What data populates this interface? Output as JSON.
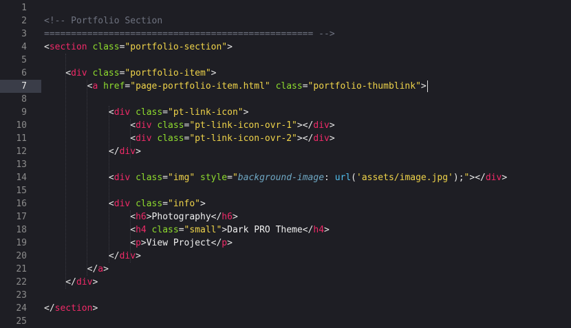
{
  "editor": {
    "language": "html",
    "active_line": 7,
    "colors": {
      "background": "#1e1e24",
      "active_line": "#3a3d48",
      "tag": "#f02a68",
      "attribute": "#8fdc2e",
      "string": "#f0d44a",
      "comment": "#6f7380",
      "function": "#52c0f0",
      "css_property": "#6fa8c4"
    },
    "lines": [
      [],
      [
        [
          "comment",
          "<!-- Portfolio Section"
        ]
      ],
      [
        [
          "comment",
          "================================================== -->"
        ]
      ],
      [
        [
          "punc",
          "<"
        ],
        [
          "tag",
          "section"
        ],
        [
          "punc",
          " "
        ],
        [
          "attr",
          "class"
        ],
        [
          "punc",
          "="
        ],
        [
          "str",
          "\"portfolio-section\""
        ],
        [
          "punc",
          ">"
        ]
      ],
      [],
      [
        [
          "punc",
          "    <"
        ],
        [
          "tag",
          "div"
        ],
        [
          "punc",
          " "
        ],
        [
          "attr",
          "class"
        ],
        [
          "punc",
          "="
        ],
        [
          "str",
          "\"portfolio-item\""
        ],
        [
          "punc",
          ">"
        ]
      ],
      [
        [
          "punc",
          "        <"
        ],
        [
          "tag",
          "a"
        ],
        [
          "punc",
          " "
        ],
        [
          "attr",
          "href"
        ],
        [
          "punc",
          "="
        ],
        [
          "str",
          "\"page-portfolio-item.html\""
        ],
        [
          "punc",
          " "
        ],
        [
          "attr",
          "class"
        ],
        [
          "punc",
          "="
        ],
        [
          "str",
          "\"portfolio-thumblink\""
        ],
        [
          "punc",
          ">"
        ]
      ],
      [],
      [
        [
          "punc",
          "            <"
        ],
        [
          "tag",
          "div"
        ],
        [
          "punc",
          " "
        ],
        [
          "attr",
          "class"
        ],
        [
          "punc",
          "="
        ],
        [
          "str",
          "\"pt-link-icon\""
        ],
        [
          "punc",
          ">"
        ]
      ],
      [
        [
          "punc",
          "                <"
        ],
        [
          "tag",
          "div"
        ],
        [
          "punc",
          " "
        ],
        [
          "attr",
          "class"
        ],
        [
          "punc",
          "="
        ],
        [
          "str",
          "\"pt-link-icon-ovr-1\""
        ],
        [
          "punc",
          "></"
        ],
        [
          "tag",
          "div"
        ],
        [
          "punc",
          ">"
        ]
      ],
      [
        [
          "punc",
          "                <"
        ],
        [
          "tag",
          "div"
        ],
        [
          "punc",
          " "
        ],
        [
          "attr",
          "class"
        ],
        [
          "punc",
          "="
        ],
        [
          "str",
          "\"pt-link-icon-ovr-2\""
        ],
        [
          "punc",
          "></"
        ],
        [
          "tag",
          "div"
        ],
        [
          "punc",
          ">"
        ]
      ],
      [
        [
          "punc",
          "            </"
        ],
        [
          "tag",
          "div"
        ],
        [
          "punc",
          ">"
        ]
      ],
      [],
      [
        [
          "punc",
          "            <"
        ],
        [
          "tag",
          "div"
        ],
        [
          "punc",
          " "
        ],
        [
          "attr",
          "class"
        ],
        [
          "punc",
          "="
        ],
        [
          "str",
          "\"img\""
        ],
        [
          "punc",
          " "
        ],
        [
          "attr",
          "style"
        ],
        [
          "punc",
          "="
        ],
        [
          "str",
          "\""
        ],
        [
          "cssprop",
          "background-image"
        ],
        [
          "punc",
          ": "
        ],
        [
          "func",
          "url"
        ],
        [
          "punc",
          "("
        ],
        [
          "str",
          "'assets/image.jpg'"
        ],
        [
          "punc",
          ");"
        ],
        [
          "str",
          "\""
        ],
        [
          "punc",
          "></"
        ],
        [
          "tag",
          "div"
        ],
        [
          "punc",
          ">"
        ]
      ],
      [],
      [
        [
          "punc",
          "            <"
        ],
        [
          "tag",
          "div"
        ],
        [
          "punc",
          " "
        ],
        [
          "attr",
          "class"
        ],
        [
          "punc",
          "="
        ],
        [
          "str",
          "\"info\""
        ],
        [
          "punc",
          ">"
        ]
      ],
      [
        [
          "punc",
          "                <"
        ],
        [
          "tag",
          "h6"
        ],
        [
          "punc",
          ">"
        ],
        [
          "text",
          "Photography"
        ],
        [
          "punc",
          "</"
        ],
        [
          "tag",
          "h6"
        ],
        [
          "punc",
          ">"
        ]
      ],
      [
        [
          "punc",
          "                <"
        ],
        [
          "tag",
          "h4"
        ],
        [
          "punc",
          " "
        ],
        [
          "attr",
          "class"
        ],
        [
          "punc",
          "="
        ],
        [
          "str",
          "\"small\""
        ],
        [
          "punc",
          ">"
        ],
        [
          "text",
          "Dark PRO Theme"
        ],
        [
          "punc",
          "</"
        ],
        [
          "tag",
          "h4"
        ],
        [
          "punc",
          ">"
        ]
      ],
      [
        [
          "punc",
          "                <"
        ],
        [
          "tag",
          "p"
        ],
        [
          "punc",
          ">"
        ],
        [
          "text",
          "View Project"
        ],
        [
          "punc",
          "</"
        ],
        [
          "tag",
          "p"
        ],
        [
          "punc",
          ">"
        ]
      ],
      [
        [
          "punc",
          "            </"
        ],
        [
          "tag",
          "div"
        ],
        [
          "punc",
          ">"
        ]
      ],
      [
        [
          "punc",
          "        </"
        ],
        [
          "tag",
          "a"
        ],
        [
          "punc",
          ">"
        ]
      ],
      [
        [
          "punc",
          "    </"
        ],
        [
          "tag",
          "div"
        ],
        [
          "punc",
          ">"
        ]
      ],
      [],
      [
        [
          "punc",
          "</"
        ],
        [
          "tag",
          "section"
        ],
        [
          "punc",
          ">"
        ]
      ],
      []
    ]
  }
}
